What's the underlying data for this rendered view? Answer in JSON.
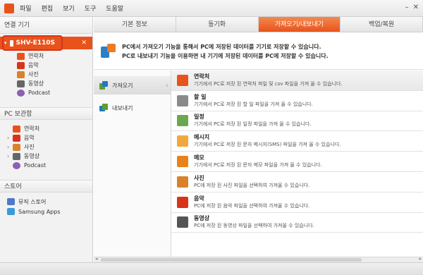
{
  "menu": [
    "파일",
    "편집",
    "보기",
    "도구",
    "도움말"
  ],
  "window_buttons": {
    "minimize": "–",
    "close": "✕"
  },
  "sidebar": {
    "connected_header": "연결 기기",
    "device_name": "SHV-E110S",
    "device_close": "✕",
    "device_items": [
      "연락처",
      "음악",
      "사진",
      "동영상",
      "Podcast"
    ],
    "pc_header": "PC 보관함",
    "pc_items": [
      "연락처",
      "음악",
      "사진",
      "동영상",
      "Podcast"
    ],
    "store_header": "스토어",
    "store_items": [
      "뮤직 스토어",
      "Samsung Apps"
    ]
  },
  "tabs": [
    "기본 정보",
    "동기화",
    "가져오기/내보내기",
    "백업/복원"
  ],
  "active_tab": 2,
  "intro": {
    "line1": "PC에서 가져오기 기능을 통해서 PC에 저장된 데이터를 기기로 저장할 수 있습니다.",
    "line2": "PC로 내보내기 기능을 이용하면 내 기기에 저장된 데이터를 PC에 저장할 수 있습니다."
  },
  "left_panel": [
    "가져오기",
    "내보내기"
  ],
  "rows": [
    {
      "title": "연락처",
      "desc": "기기에서 PC로 저장 된 연락처 파일 및 csv 파일을 가져 올 수 있습니다.",
      "icon": "contact-icon",
      "color": "#e8531c"
    },
    {
      "title": "할 일",
      "desc": "기기에서 PC로 저장 된 할 일 파일을 가져 올 수 있습니다.",
      "icon": "todo-icon",
      "color": "#8a8a8a"
    },
    {
      "title": "일정",
      "desc": "기기에서 PC로 저장 된 일정 파일을 가져 올 수 있습니다.",
      "icon": "calendar-icon",
      "color": "#6aa84f"
    },
    {
      "title": "메시지",
      "desc": "기기에서 PC로 저장 된 문자 메시지(SMS) 파일을 가져 올 수 있습니다.",
      "icon": "message-icon",
      "color": "#f2a93b"
    },
    {
      "title": "메모",
      "desc": "기기에서 PC로 저장 된 문자 메모 파일을 가져 올 수 있습니다.",
      "icon": "memo-icon",
      "color": "#e8831c"
    },
    {
      "title": "사진",
      "desc": "PC에 저장 된 사진 파일을 선택하여 가져올 수 있습니다.",
      "icon": "photo-icon",
      "color": "#d9822b"
    },
    {
      "title": "음악",
      "desc": "PC에 저장 된 음악 파일을 선택하여 가져올 수 있습니다.",
      "icon": "music-icon",
      "color": "#d8341a"
    },
    {
      "title": "동영상",
      "desc": "PC에 저장 된 동영상 파일을 선택하여 가져올 수 있습니다.",
      "icon": "video-icon",
      "color": "#555555"
    }
  ],
  "colors": {
    "accent": "#e8531c"
  }
}
